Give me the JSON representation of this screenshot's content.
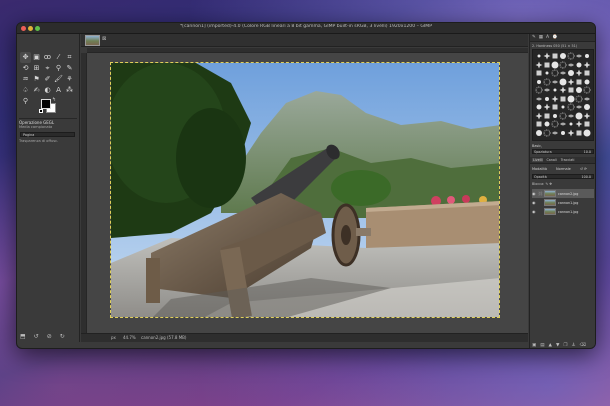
{
  "window": {
    "title": "*[cannon1] (imported)-4.0 (Colore RGB lineari a 8 bit gamma, GIMP built-in sRGB, 3 livelli) 1920x1200 – GIMP"
  },
  "toolbox": {
    "tools": [
      "move-icon",
      "rect-select-icon",
      "lasso-icon",
      "fuzzy-select-icon",
      "crop-icon",
      "transform-icon",
      "warp-icon",
      "paths-icon",
      "text-icon",
      "paint-icon",
      "bucket-icon",
      "gradient-icon",
      "pencil-icon",
      "brush-icon",
      "clone-icon",
      "smudge-icon",
      "dodge-icon",
      "text-tool-icon",
      "eyedropper-icon",
      "zoom-icon"
    ],
    "options_title": "Operazione GEGL",
    "option_1": "Media campionata",
    "select_value": "Pagina",
    "option_2": "Trasparenza di offusc."
  },
  "canvas": {
    "status_unit": "px",
    "status_zoom": "44.7%",
    "status_info": "cannon2.jpg (57.8 MB)"
  },
  "dock": {
    "brush_title": "2. Hardness 050 (51 × 51)",
    "brush_name": "Basic,",
    "spacing_label": "Spaziatura",
    "spacing_value": "10.0",
    "layer_tabs": [
      "Livelli",
      "Canali",
      "Tracciati"
    ],
    "mode_label": "Modalità",
    "mode_value": "Normale",
    "opacity_label": "Opacità",
    "opacity_value": "100.0",
    "lock_label": "Blocca:",
    "layers": [
      {
        "name": "cannon2.jpg",
        "selected": true
      },
      {
        "name": "cannon1.jpg",
        "selected": false
      },
      {
        "name": "cannon1.jpg",
        "selected": false
      }
    ]
  },
  "colors": {
    "foreground": "#000000",
    "background": "#ffffff",
    "selection_marquee": "#e0d05a"
  }
}
